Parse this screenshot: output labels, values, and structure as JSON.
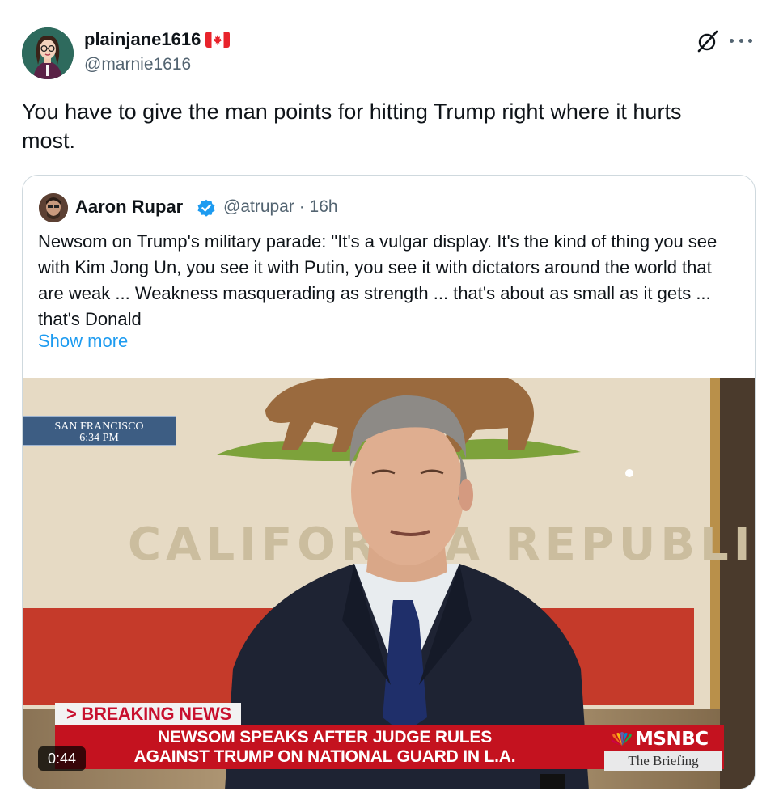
{
  "post": {
    "author_name": "plainjane1616",
    "flag_icon": "canada-flag-icon",
    "author_handle": "@marnie1616",
    "text": "You have to give the man points for hitting Trump right where it hurts most."
  },
  "quoted": {
    "author_name": "Aaron Rupar",
    "verified": true,
    "meta": "@atrupar · 16h",
    "text": "Newsom on Trump's military parade: \"It's a vulgar display. It's the kind of thing you see with Kim Jong Un, you see it with Putin, you see it with dictators around the world that are weak ... Weakness masquerading as strength ... that's about as small as it gets ... that's Donald",
    "show_more": "Show more",
    "video": {
      "location_line1": "SAN FRANCISCO",
      "location_line2": "6:34 PM",
      "flag_text": "CALIFORNIA REPUBLIC",
      "breaking_label": "> BREAKING NEWS",
      "headline_line1": "NEWSOM SPEAKS AFTER JUDGE RULES",
      "headline_line2": "AGAINST TRUMP ON NATIONAL GUARD IN L.A.",
      "network": "MSNBC",
      "show_name": "The Briefing",
      "duration": "0:44"
    }
  },
  "colors": {
    "text_primary": "#0f1419",
    "text_secondary": "#536471",
    "link": "#1d9bf0",
    "verified": "#1d9bf0",
    "border": "#cfd9de",
    "breaking_red": "#c4121f"
  }
}
